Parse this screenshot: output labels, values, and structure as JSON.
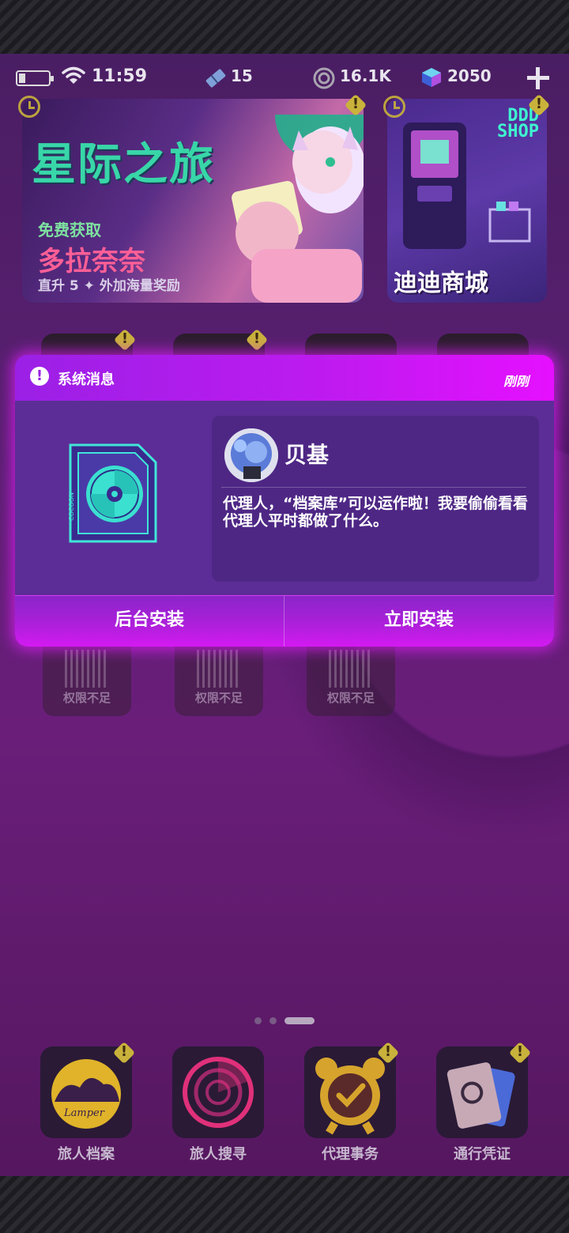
{
  "status_bar": {
    "time": "11:59",
    "tickets": "15",
    "coins": "16.1K",
    "gems": "2050"
  },
  "banners": {
    "left": {
      "title": "星际之旅",
      "sub_line1": "免费获取",
      "sub_line2": "多拉奈奈",
      "sub_line3": "直升 5 ✦ 外加海量奖励"
    },
    "right": {
      "logo_line1": "DDD",
      "logo_line2": "SHOP",
      "label": "迪迪商城"
    }
  },
  "dialog": {
    "title": "系统消息",
    "time": "刚刚",
    "sender": "贝基",
    "message": "代理人，“档案库”可以运作啦！我要偷偷看看代理人平时都做了什么。",
    "background_install_label": "后台安装",
    "install_now_label": "立即安装",
    "app_icon_text": "COCOON"
  },
  "locked_tiles": [
    {
      "label": "权限不足"
    },
    {
      "label": "权限不足"
    },
    {
      "label": "权限不足"
    }
  ],
  "dock": [
    {
      "label": "旅人档案",
      "icon": "traveler-archive-icon"
    },
    {
      "label": "旅人搜寻",
      "icon": "radar-icon"
    },
    {
      "label": "代理事务",
      "icon": "alarm-clock-icon"
    },
    {
      "label": "通行凭证",
      "icon": "pass-card-icon"
    }
  ],
  "colors": {
    "accent_magenta": "#e510ff",
    "accent_purple": "#9b20e6",
    "warning_yellow": "#c9b23b",
    "teal": "#38d6a8"
  }
}
